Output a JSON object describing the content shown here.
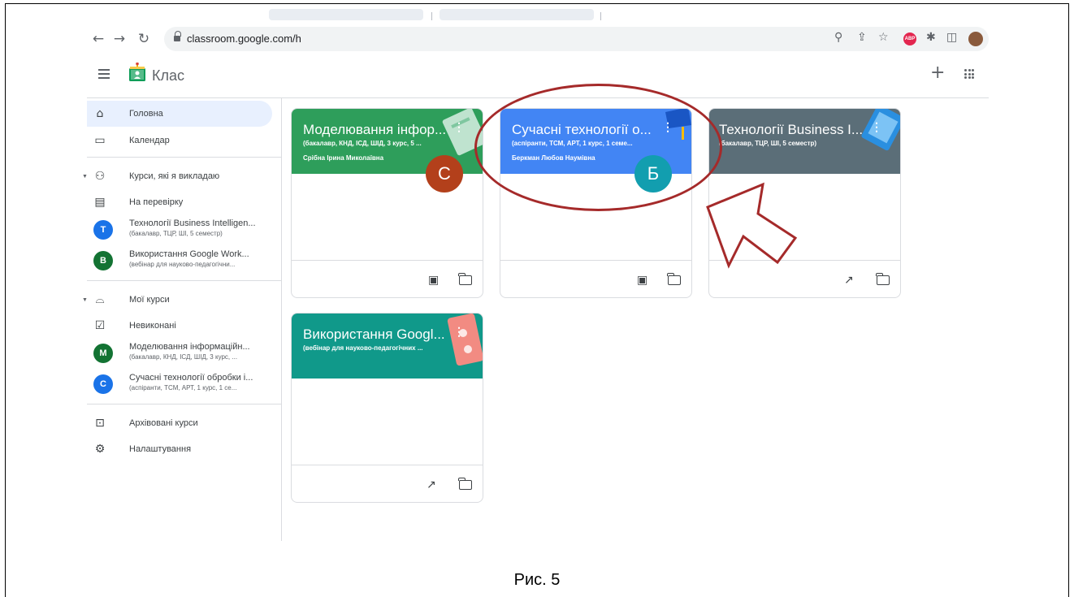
{
  "browser": {
    "url": "classroom.google.com/h",
    "back_icon": "arrow-left",
    "forward_icon": "arrow-right",
    "reload_icon": "reload"
  },
  "app": {
    "title": "Клас",
    "plus_label": "+"
  },
  "sidebar": {
    "home": "Головна",
    "calendar": "Календар",
    "teaching": "Курси, які я викладаю",
    "to_review": "На перевірку",
    "teaching_courses": [
      {
        "letter": "T",
        "title": "Технології Business Intelligen...",
        "sub": "(бакалавр, ТЦР, ШІ, 5 семестр)",
        "color": "#1a73e8"
      },
      {
        "letter": "B",
        "title": "Використання Google Work...",
        "sub": "(вебінар для науково-педагогічни...",
        "color": "#137333"
      }
    ],
    "enrolled": "Мої курси",
    "todo": "Невиконані",
    "enrolled_courses": [
      {
        "letter": "M",
        "title": "Моделювання інформаційн...",
        "sub": "(бакалавр, КНД, ІСД, ШІД, 3 курс, ...",
        "color": "#137333"
      },
      {
        "letter": "C",
        "title": "Сучасні технології обробки і...",
        "sub": "(аспіранти, ТСМ, АРТ, 1 курс, 1 се...",
        "color": "#1a73e8"
      }
    ],
    "archived": "Архівовані курси",
    "settings": "Налаштування"
  },
  "cards": [
    {
      "title": "Моделювання інфор...",
      "section": "(бакалавр, КНД, ІСД, ШІД, 3 курс, 5 ...",
      "teacher": "Срібна Ірина Миколаївна",
      "owner_letter": "С",
      "banner_color": "#2e9e5b",
      "owner_color": "#b3401b"
    },
    {
      "title": "Сучасні технології о...",
      "section": "(аспіранти, ТСМ, АРТ, 1 курс, 1 семе...",
      "teacher": "Беркман Любов Наумівна",
      "owner_letter": "Б",
      "banner_color": "#4285f4",
      "owner_color": "#129eaf"
    },
    {
      "title": "Технології Business I...",
      "section": "(бакалавр, ТЦР, ШІ, 5 семестр)",
      "teacher": "",
      "owner_letter": "",
      "banner_color": "#5b6e78",
      "owner_color": ""
    },
    {
      "title": "Використання Googl...",
      "section": "(вебінар для науково-педагогічних ...",
      "teacher": "",
      "owner_letter": "",
      "banner_color": "#10998a",
      "owner_color": ""
    }
  ],
  "caption": "Рис. 5",
  "annotation_color": "#a52a2a"
}
